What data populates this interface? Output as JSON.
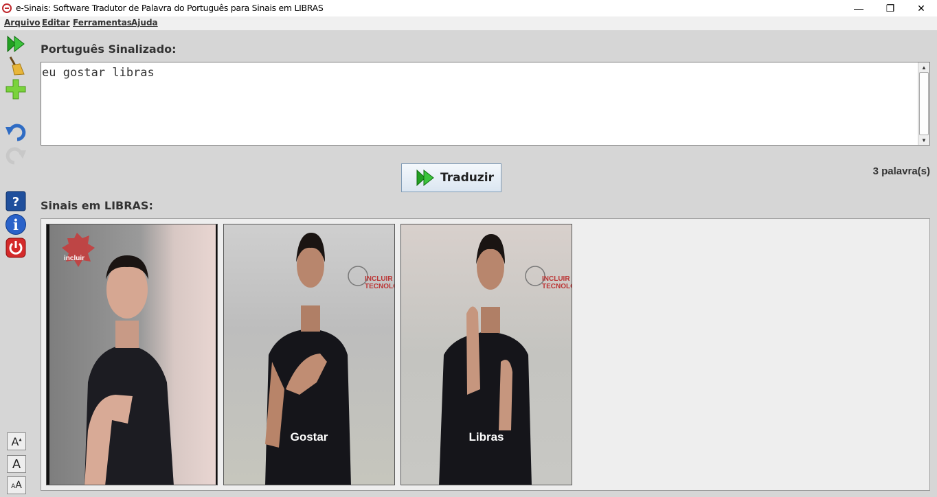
{
  "window": {
    "title": "e-Sinais: Software Tradutor de Palavra do Português para Sinais em LIBRAS",
    "minimize_glyph": "—",
    "restore_glyph": "❐",
    "close_glyph": "✕"
  },
  "menu": {
    "items": [
      {
        "label": "Arquivo"
      },
      {
        "label": "Editar"
      },
      {
        "label": "Ferramentas"
      },
      {
        "label": "Ajuda"
      }
    ]
  },
  "sidebar": {
    "tools": [
      "play-icon",
      "broom-icon",
      "add-icon",
      "undo-icon",
      "redo-icon",
      "help-icon",
      "info-icon",
      "power-icon"
    ],
    "font_tools": [
      "font-decrease-icon",
      "font-default-icon",
      "font-increase-icon"
    ]
  },
  "input": {
    "label": "Português Sinalizado:",
    "value": "eu gostar libras"
  },
  "translate_button": {
    "label": "Traduzir"
  },
  "word_count": "3 palavra(s)",
  "signs": {
    "label": "Sinais em LIBRAS:",
    "items": [
      {
        "caption": "",
        "logo": "incluir"
      },
      {
        "caption": "Gostar",
        "logo": "INCLUIR TECNOLOGIA"
      },
      {
        "caption": "Libras",
        "logo": "INCLUIR TECNOLOGIA"
      }
    ]
  },
  "colors": {
    "accent_green": "#2fb52f",
    "window_bg": "#d6d6d6",
    "panel_bg": "#eeeeee"
  }
}
